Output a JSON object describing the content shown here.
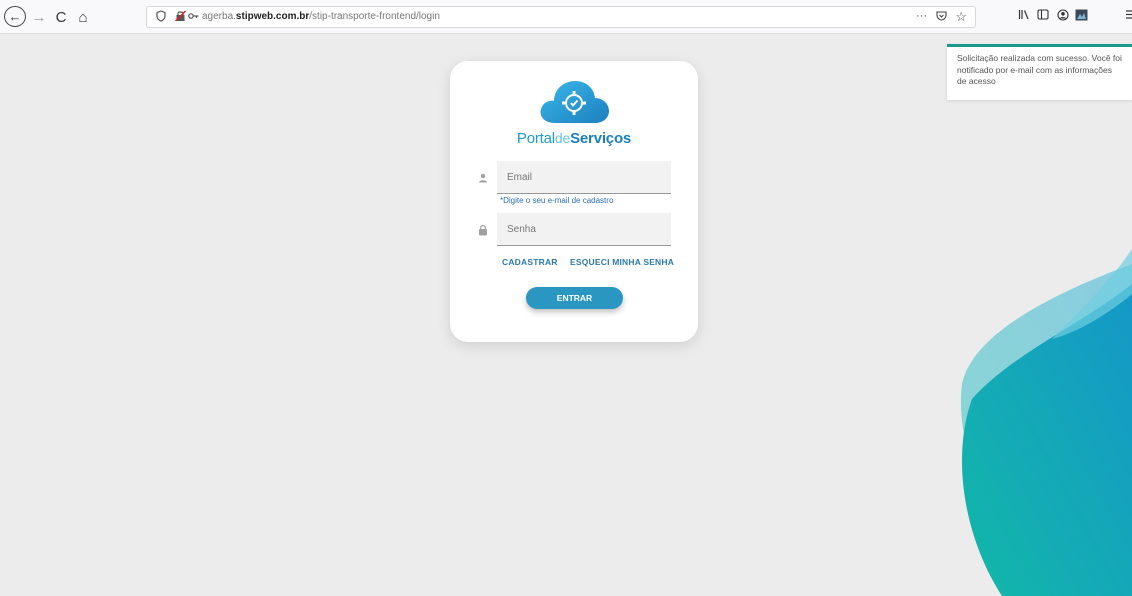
{
  "browser": {
    "url_domain_prefix": "agerba.",
    "url_domain": "stipweb.com.br",
    "url_path": "/stip-transporte-frontend/login",
    "more_glyph": "···",
    "nav": {
      "back": "←",
      "forward": "→",
      "reload": "C",
      "home": "⌂"
    }
  },
  "toast": {
    "message": "Solicitação realizada com sucesso. Você foi notificado por e-mail com as informações de acesso",
    "accent_color": "#1a9a8c"
  },
  "logo": {
    "part1": "Portal",
    "part2": "de",
    "part3": "Serviços"
  },
  "form": {
    "email_placeholder": "Email",
    "email_hint": "*Digite o seu e-mail de cadastro",
    "password_placeholder": "Senha",
    "register_label": "CADASTRAR",
    "forgot_label": "ESQUECI MINHA SENHA",
    "submit_label": "ENTRAR"
  },
  "colors": {
    "brand": "#2a97c2",
    "background": "#ececec"
  }
}
